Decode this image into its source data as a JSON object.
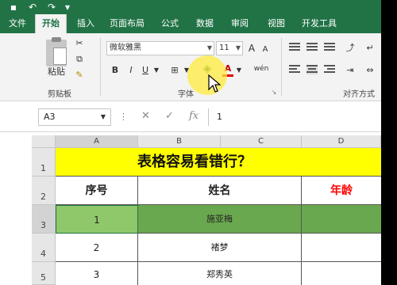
{
  "tabs": [
    "文件",
    "开始",
    "插入",
    "页面布局",
    "公式",
    "数据",
    "审阅",
    "视图",
    "开发工具"
  ],
  "ribbon": {
    "paste_label": "粘贴",
    "clipboard_label": "剪贴板",
    "font_name": "微软雅黑",
    "font_size": "11",
    "bold": "B",
    "italic": "I",
    "underline": "U",
    "font_group_label": "字体",
    "align_group_label": "对齐方式",
    "grow_font": "A",
    "shrink_font": "A",
    "font_color": "A",
    "phonetic": "wén"
  },
  "formula_bar": {
    "name_box": "A3",
    "fx": "fx",
    "content": "1"
  },
  "columns": [
    "A",
    "B",
    "C",
    "D"
  ],
  "rows": [
    "1",
    "2",
    "3",
    "4",
    "5"
  ],
  "sheet": {
    "title": "表格容易看错行？",
    "header_no": "序号",
    "header_name": "姓名",
    "header_age": "年龄",
    "data": [
      {
        "no": "1",
        "name": "施亚梅"
      },
      {
        "no": "2",
        "name": "褚梦"
      },
      {
        "no": "3",
        "name": "郑秀英"
      }
    ]
  },
  "colors": {
    "accent": "#217346",
    "title_fill": "#ffff00",
    "selected_row": "#6aa84f",
    "age_header": "#ff0000"
  }
}
